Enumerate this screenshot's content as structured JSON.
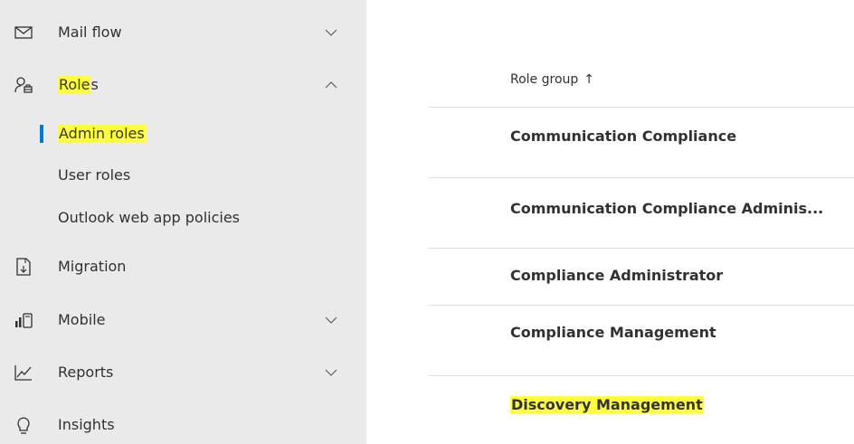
{
  "sidebar": {
    "items": [
      {
        "label": "Mail flow",
        "icon": "mail-icon",
        "expandable": true,
        "expanded": false
      },
      {
        "label_parts": [
          "Role",
          "s"
        ],
        "icon": "roles-icon",
        "expandable": true,
        "expanded": true,
        "children": [
          {
            "label": "Admin roles",
            "active": true
          },
          {
            "label": "User roles"
          },
          {
            "label": "Outlook web app policies"
          }
        ]
      },
      {
        "label": "Migration",
        "icon": "migration-icon",
        "expandable": false
      },
      {
        "label": "Mobile",
        "icon": "mobile-icon",
        "expandable": true,
        "expanded": false
      },
      {
        "label": "Reports",
        "icon": "reports-icon",
        "expandable": true,
        "expanded": false
      },
      {
        "label": "Insights",
        "icon": "insights-icon",
        "expandable": false
      }
    ],
    "accent_color": "#0078d4",
    "highlight_color": "#ffff3c"
  },
  "table": {
    "column_header": "Role group",
    "sort_arrow": "↑",
    "rows": [
      {
        "label": "Communication Compliance"
      },
      {
        "label": "Communication Compliance Adminis..."
      },
      {
        "label": "Compliance Administrator"
      },
      {
        "label": "Compliance Management"
      },
      {
        "label": "Discovery Management",
        "highlighted": true
      }
    ]
  }
}
